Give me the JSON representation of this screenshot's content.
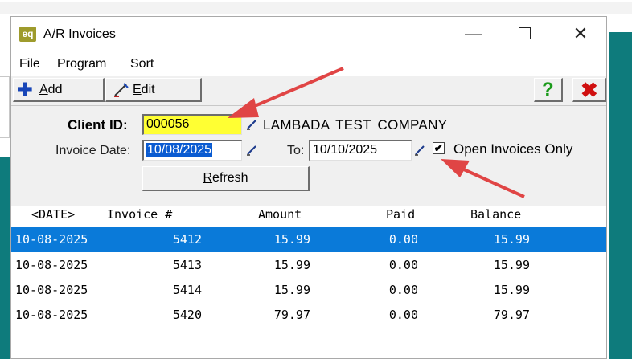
{
  "window": {
    "title": "A/R Invoices",
    "app_icon": "eq",
    "controls": [
      "minimize-icon",
      "maximize-icon",
      "close-icon"
    ]
  },
  "menu": [
    "File",
    "Program",
    "Sort"
  ],
  "toolbar": {
    "add_label": "Add",
    "edit_label": "Edit",
    "help_icon": "?",
    "exit_icon": "✖"
  },
  "form": {
    "client_id_label": "Client ID:",
    "client_id_value": "000056",
    "client_name": "LAMBADA  TEST COMPANY",
    "invoice_date_label": "Invoice Date:",
    "invoice_date_value": "10/08/2025",
    "to_label": "To:",
    "to_value": "10/10/2025",
    "open_only_label": "Open Invoices Only",
    "open_only_checked": "✔",
    "refresh_label": "Refresh"
  },
  "grid": {
    "headers": [
      "<DATE>",
      "Invoice #",
      "Amount",
      "Paid",
      "Balance"
    ],
    "rows": [
      {
        "date": "10-08-2025",
        "invoice": "5412",
        "amount": "15.99",
        "paid": "0.00",
        "balance": "15.99"
      },
      {
        "date": "10-08-2025",
        "invoice": "5413",
        "amount": "15.99",
        "paid": "0.00",
        "balance": "15.99"
      },
      {
        "date": "10-08-2025",
        "invoice": "5414",
        "amount": "15.99",
        "paid": "0.00",
        "balance": "15.99"
      },
      {
        "date": "10-08-2025",
        "invoice": "5420",
        "amount": "79.97",
        "paid": "0.00",
        "balance": "79.97"
      }
    ],
    "selected_row": 0
  },
  "colors": {
    "highlight_yellow": "#ffff33",
    "selection_blue": "#0a7ad9",
    "annotation_red": "#e04545",
    "background_teal": "#0e7b7c"
  }
}
